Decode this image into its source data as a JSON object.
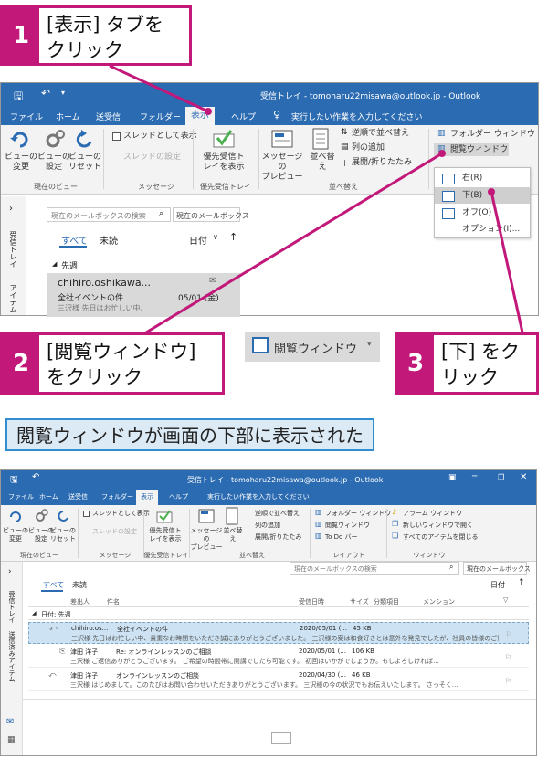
{
  "callouts": {
    "c1": {
      "num": "1",
      "text": "[表示] タブを\nクリック"
    },
    "c2": {
      "num": "2",
      "text": "[閲覧ウィンドウ]\nをクリック"
    },
    "c3": {
      "num": "3",
      "text": "[下] をク\nリック"
    }
  },
  "caption": "閲覧ウィンドウが画面の下部に表示された",
  "top_window": {
    "title": "受信トレイ - tomoharu22misawa@outlook.jp  -  Outlook",
    "tabs": [
      "ファイル",
      "ホーム",
      "送受信",
      "フォルダー",
      "表示",
      "ヘルプ"
    ],
    "tell_me": "実行したい作業を入力してください",
    "ribbon": {
      "view_change": "ビューの\n変更",
      "view_settings": "ビューの\n設定",
      "view_reset": "ビューの\nリセット",
      "show_as_thread": "スレッドとして表示",
      "thread_settings": "スレッドの設定",
      "priority_inbox": "優先受信ト\nレイを表示",
      "message_preview": "メッセージの\nプレビュー",
      "sort": "並べ替\nえ",
      "reverse_sort": "逆順で並べ替え",
      "add_column": "列の追加",
      "expand_collapse": "展開/折りたたみ",
      "folder_pane": "フォルダー ウィンドウ",
      "reading_pane": "閲覧ウィンドウ"
    },
    "groups": {
      "current_view": "現在のビュー",
      "messages": "メッセージ",
      "priority": "優先受信トレイ",
      "arrangement": "並べ替え"
    },
    "reading_menu": {
      "right": "右(R)",
      "bottom": "下(B)",
      "off": "オフ(O)",
      "options": "オプション(I)..."
    },
    "search_placeholder": "現在のメールボックスの検索",
    "search_scope": "現在のメールボックス",
    "filter_all": "すべて",
    "filter_unread": "未読",
    "sort_by": "日付",
    "section_head": "先週",
    "side_labels": {
      "inbox": "受信トレイ",
      "items": "アイテム"
    },
    "message": {
      "sender": "chihiro.oshikawa...",
      "subject": "全社イベントの件",
      "date": "05/01 (金)",
      "preview": "三沢様  先日はお忙しい中、"
    }
  },
  "zoom_button": {
    "label": "閲覧ウィンドウ"
  },
  "bottom_window": {
    "title": "受信トレイ - tomoharu22misawa@outlook.jp  -  Outlook",
    "tabs": [
      "ファイル",
      "ホーム",
      "送受信",
      "フォルダー",
      "表示",
      "ヘルプ"
    ],
    "tell_me": "実行したい作業を入力してください",
    "ribbon": {
      "view_change": "ビューの\n変更",
      "view_settings": "ビューの\n設定",
      "view_reset": "ビューの\nリセット",
      "show_as_thread": "スレッドとして表示",
      "thread_settings": "スレッドの設定",
      "priority_inbox": "優先受信ト\nレイを表示",
      "message_preview": "メッセージの\nプレビュー",
      "sort": "並べ替\nえ",
      "reverse_sort": "逆順で並べ替え",
      "add_column": "列の追加",
      "expand_collapse": "展開/折りたたみ",
      "folder_pane": "フォルダー ウィンドウ",
      "reading_pane": "閲覧ウィンドウ",
      "todo_bar": "To Do バー",
      "reminder_window": "アラーム ウィンドウ",
      "open_new_window": "新しいウィンドウで開く",
      "close_all_items": "すべてのアイテムを閉じる"
    },
    "groups": {
      "current_view": "現在のビュー",
      "messages": "メッセージ",
      "priority": "優先受信トレイ",
      "arrangement": "並べ替え",
      "layout": "レイアウト",
      "window": "ウィンドウ"
    },
    "search_placeholder": "現在のメールボックスの検索",
    "search_scope": "現在のメールボックス",
    "filter_all": "すべて",
    "filter_unread": "未読",
    "sort_by": "日付",
    "columns": [
      "差出人",
      "件名",
      "受信日時",
      "サイズ",
      "分類項目",
      "メンション"
    ],
    "group_head": "日付: 先週",
    "side_labels": {
      "inbox": "受信トレイ",
      "items": "送信済みアイテム"
    },
    "rows": [
      {
        "sender": "chihiro.os...",
        "subject": "全社イベントの件",
        "date": "2020/05/01 (...",
        "size": "45 KB",
        "preview": "三沢様  先日はお忙しい中、貴重なお時間をいただき誠にありがとうございました。  三沢様の案は和食好きとは意外な発見でしたが、社員の皆様のご賛同も..."
      },
      {
        "sender": "津田 洋子",
        "subject": "Re: オンラインレッスンのご相談",
        "date": "2020/05/01 (...",
        "size": "106 KB",
        "preview": "三沢様  ご返信ありがとうございます。  ご希望の時間帯に開講でしたら可能です。  初回はいかがでしょうか。もしよろしければ..."
      },
      {
        "sender": "津田 洋子",
        "subject": "オンラインレッスンのご相談",
        "date": "2020/04/30 (...",
        "size": "46 KB",
        "preview": "三沢様  はじめまして。このたびはお問い合わせいただきありがとうございます。  三沢様の今の状況でもお伝えいたします。  さっそく..."
      }
    ]
  }
}
